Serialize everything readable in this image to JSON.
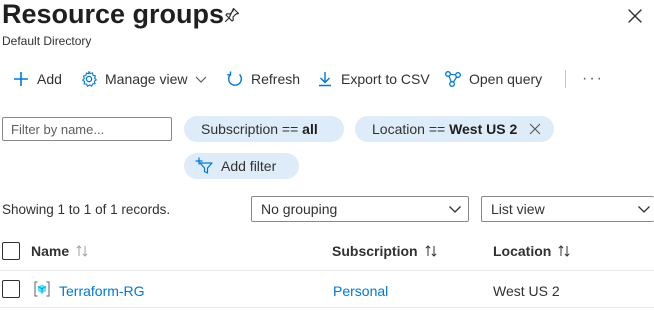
{
  "header": {
    "title": "Resource groups",
    "subtitle": "Default Directory"
  },
  "toolbar": {
    "add": "Add",
    "manage_view": "Manage view",
    "refresh": "Refresh",
    "export": "Export to CSV",
    "open_query": "Open query",
    "more": "···"
  },
  "filters": {
    "name_placeholder": "Filter by name...",
    "subscription_prefix": "Subscription == ",
    "subscription_value": "all",
    "location_prefix": "Location == ",
    "location_value": "West US 2",
    "add_filter": "Add filter"
  },
  "summary": {
    "records": "Showing 1 to 1 of 1 records.",
    "grouping": "No grouping",
    "view": "List view"
  },
  "table": {
    "columns": [
      "Name",
      "Subscription",
      "Location"
    ],
    "rows": [
      {
        "name": "Terraform-RG",
        "subscription": "Personal",
        "location": "West US 2"
      }
    ]
  },
  "colors": {
    "accent": "#0078d4",
    "pill_background": "#deecf9",
    "text": "#323130"
  },
  "icons": [
    "pin-icon",
    "close-icon",
    "plus-icon",
    "gear-icon",
    "refresh-icon",
    "download-icon",
    "query-icon",
    "filter-add-icon",
    "chevron-down-icon",
    "sort-icon",
    "resource-group-icon"
  ]
}
